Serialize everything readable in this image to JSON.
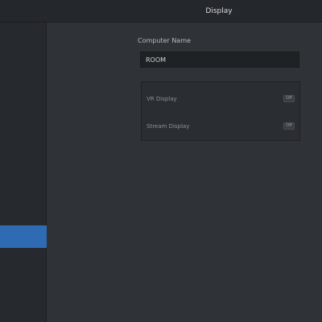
{
  "window": {
    "title": "Display"
  },
  "sidebar": {
    "section_label": "",
    "items": [
      {
        "label": ""
      },
      {
        "label": ""
      },
      {
        "label": ""
      }
    ]
  },
  "form": {
    "field_label": "Computer Name",
    "field_value": "ROOM"
  },
  "options": [
    {
      "label": "VR Display",
      "state": "Off"
    },
    {
      "label": "Stream Display",
      "state": "Off"
    }
  ],
  "colors": {
    "accent": "#2f6bb3",
    "background": "#2f3237",
    "sidebar": "#26292d"
  }
}
